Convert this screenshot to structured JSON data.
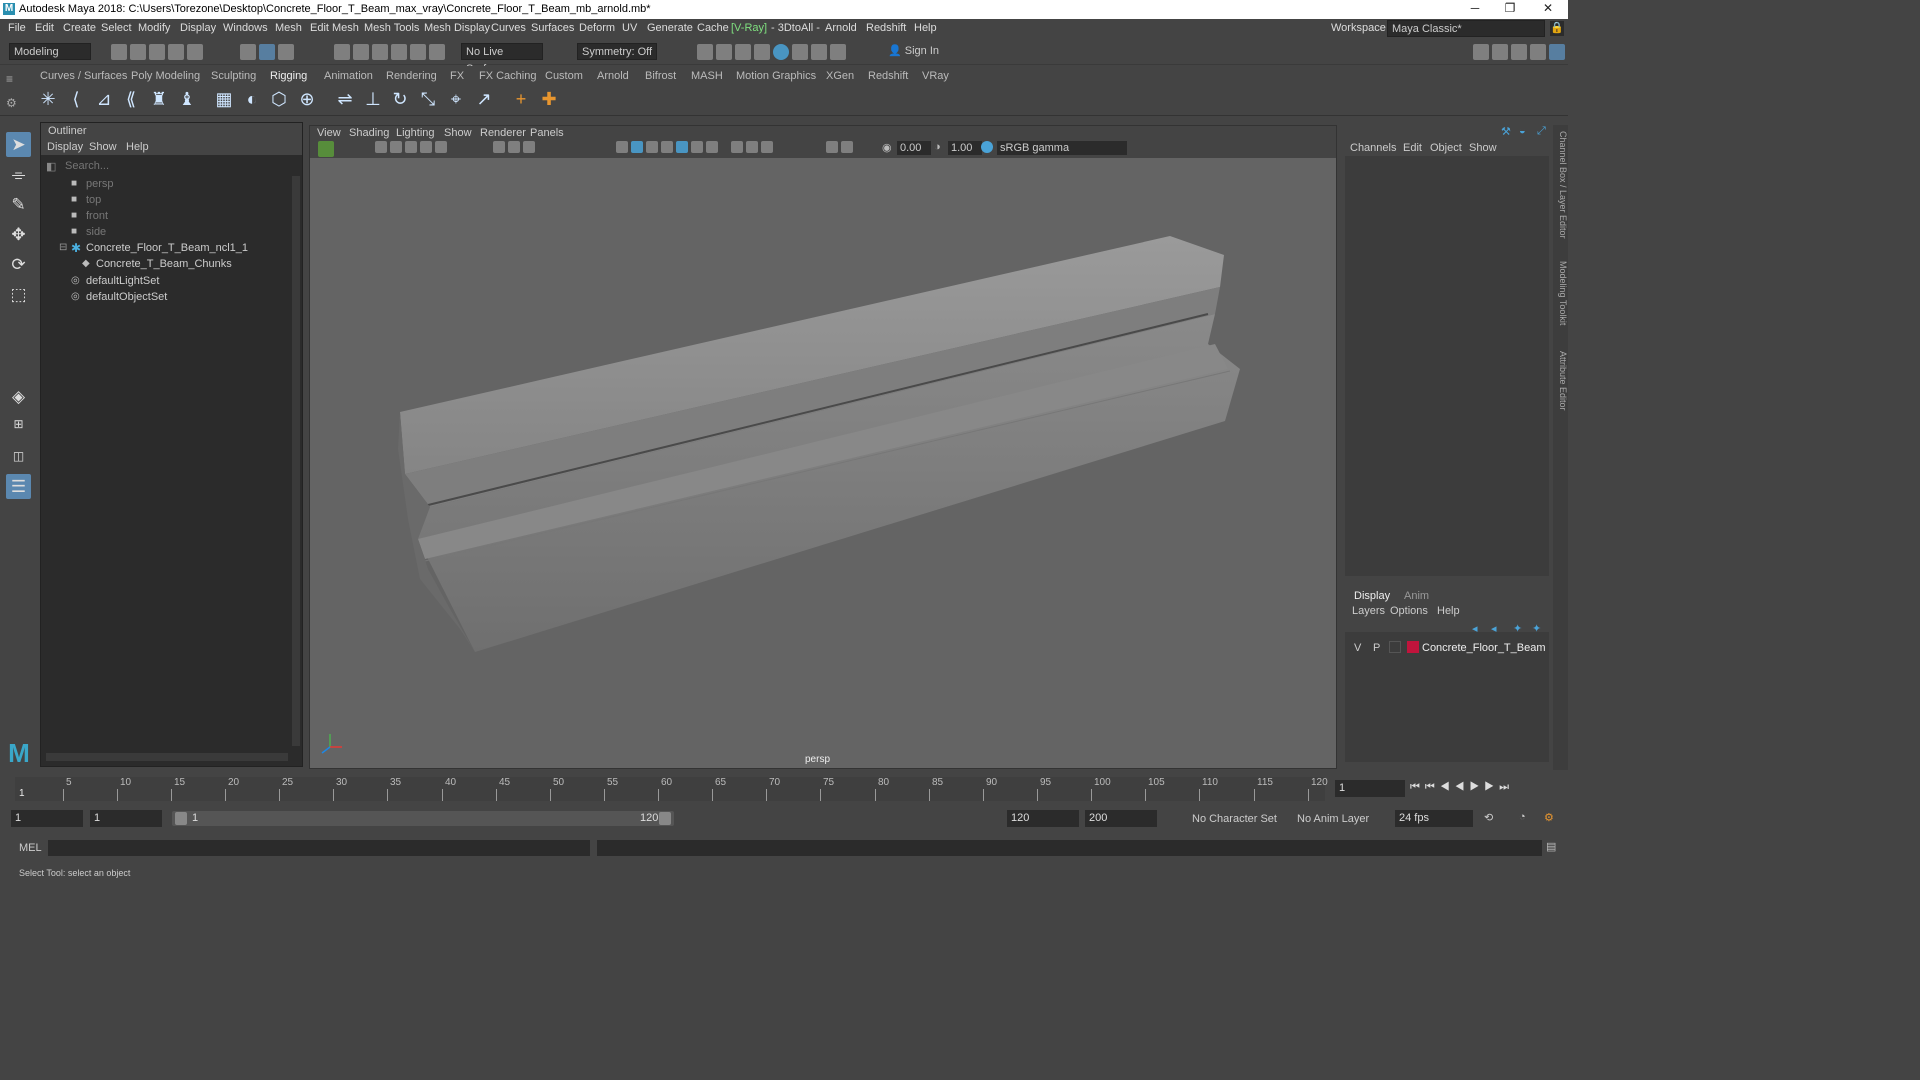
{
  "title": "Autodesk Maya 2018: C:\\Users\\Torezone\\Desktop\\Concrete_Floor_T_Beam_max_vray\\Concrete_Floor_T_Beam_mb_arnold.mb*",
  "menu": [
    "File",
    "Edit",
    "Create",
    "Select",
    "Modify",
    "Display",
    "Windows",
    "Mesh",
    "Edit Mesh",
    "Mesh Tools",
    "Mesh Display",
    "Curves",
    "Surfaces",
    "Deform",
    "UV",
    "Generate",
    "Cache",
    "[V-Ray]",
    "- 3DtoAll -",
    "Arnold",
    "Redshift",
    "Help"
  ],
  "workspace_label": "Workspace :",
  "workspace_value": "Maya Classic*",
  "mode_value": "Modeling",
  "live_surface": "No Live Surface",
  "symmetry": "Symmetry: Off",
  "sign_in": "Sign In",
  "shelf_tabs": [
    "Curves / Surfaces",
    "Poly Modeling",
    "Sculpting",
    "Rigging",
    "Animation",
    "Rendering",
    "FX",
    "FX Caching",
    "Custom",
    "Arnold",
    "Bifrost",
    "MASH",
    "Motion Graphics",
    "XGen",
    "Redshift",
    "VRay"
  ],
  "active_shelf": "Rigging",
  "outliner": {
    "title": "Outliner",
    "menu": [
      "Display",
      "Show",
      "Help"
    ],
    "search_placeholder": "Search...",
    "items": [
      "persp",
      "top",
      "front",
      "side",
      "Concrete_Floor_T_Beam_ncl1_1",
      "Concrete_T_Beam_Chunks",
      "defaultLightSet",
      "defaultObjectSet"
    ]
  },
  "viewport": {
    "menu": [
      "View",
      "Shading",
      "Lighting",
      "Show",
      "Renderer",
      "Panels"
    ],
    "field1": "0.00",
    "field2": "1.00",
    "color_space": "sRGB gamma",
    "camera_label": "persp"
  },
  "channelbox": {
    "menu": [
      "Channels",
      "Edit",
      "Object",
      "Show"
    ]
  },
  "layers": {
    "tabs": [
      "Display",
      "Anim"
    ],
    "menu": [
      "Layers",
      "Options",
      "Help"
    ],
    "layer": {
      "v": "V",
      "p": "P",
      "name": "Concrete_Floor_T_Beam",
      "color": "#c0143c"
    }
  },
  "side_tabs": [
    "Channel Box / Layer Editor",
    "Modeling Toolkit",
    "Attribute Editor"
  ],
  "timeline": {
    "ticks": [
      5,
      10,
      15,
      20,
      25,
      30,
      35,
      40,
      45,
      50,
      55,
      60,
      65,
      70,
      75,
      80,
      85,
      90,
      95,
      100,
      105,
      110,
      115,
      120
    ],
    "start_label": "1",
    "current_frame": "1"
  },
  "range": {
    "start": "1",
    "start2": "1",
    "slider_start": "1",
    "slider_end": "120",
    "end": "120",
    "end2": "200",
    "char_set": "No Character Set",
    "anim_layer": "No Anim Layer",
    "fps": "24 fps"
  },
  "mel_label": "MEL",
  "status_text": "Select Tool: select an object",
  "accent": "#5b88b0"
}
